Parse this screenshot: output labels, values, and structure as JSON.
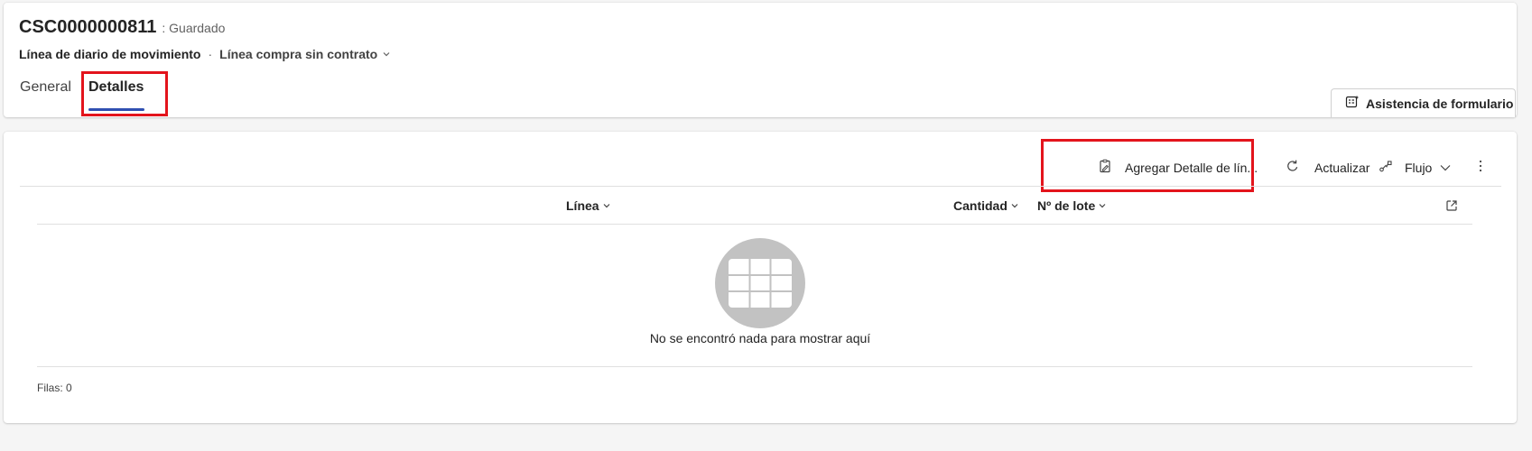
{
  "header": {
    "record_title": "CSC0000000811",
    "saved_status": ": Guardado",
    "entity_name": "Línea de diario de movimiento",
    "separator": "·",
    "form_name": "Línea compra sin contrato"
  },
  "tabs": [
    {
      "label": "General",
      "selected": false
    },
    {
      "label": "Detalles",
      "selected": true
    }
  ],
  "form_assist": {
    "label": "Asistencia de formulario"
  },
  "grid": {
    "commands": {
      "add_label": "Agregar Detalle de lín...",
      "refresh_label": "Actualizar",
      "flow_label": "Flujo"
    },
    "columns": [
      "Línea",
      "Cantidad",
      "Nº de lote"
    ],
    "empty_message": "No se encontró nada para mostrar aquí",
    "row_count": "Filas: 0"
  },
  "colors": {
    "accent": "#2f4fb1",
    "highlight": "#e3141c",
    "empty_illustration": "#c2c2c2"
  },
  "icons": [
    "chevron-down-icon",
    "form-assist-icon",
    "add-detail-icon",
    "refresh-icon",
    "flow-icon",
    "more-options-icon",
    "popout-icon",
    "empty-grid-icon"
  ]
}
